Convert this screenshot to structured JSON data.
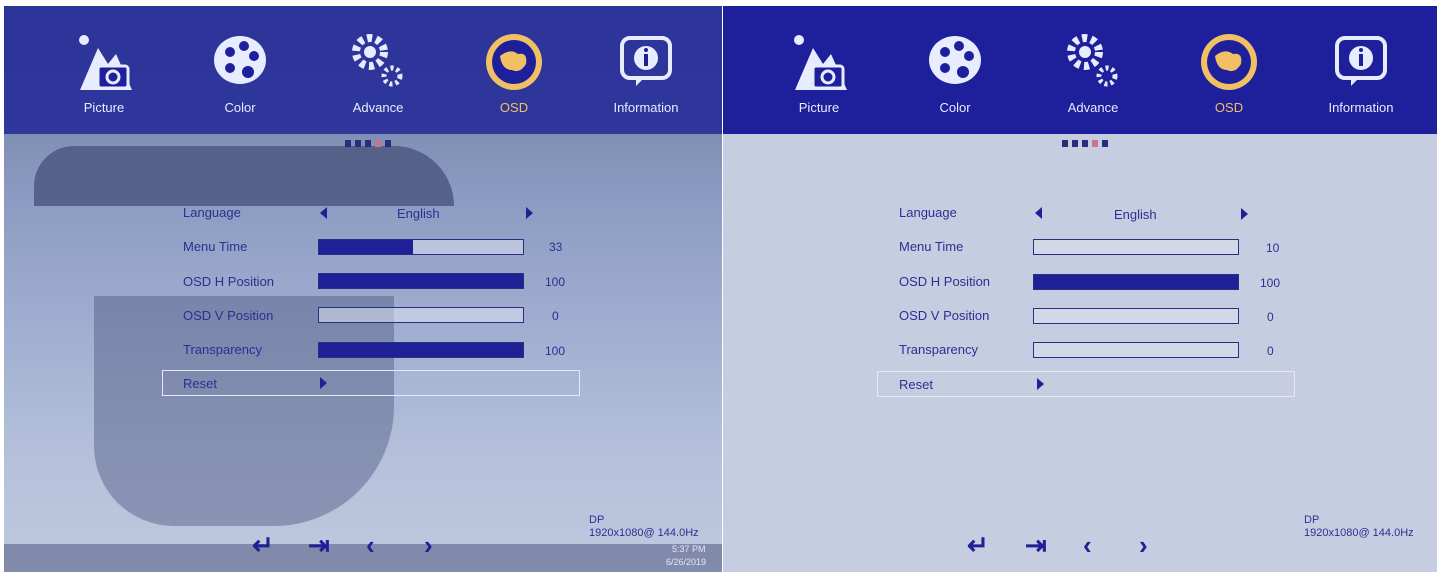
{
  "screens": [
    {
      "tabs": [
        {
          "label": "Picture",
          "icon": "picture-icon"
        },
        {
          "label": "Color",
          "icon": "color-palette-icon"
        },
        {
          "label": "Advance",
          "icon": "gear-icon"
        },
        {
          "label": "OSD",
          "icon": "globe-icon",
          "active": true
        },
        {
          "label": "Information",
          "icon": "info-icon"
        }
      ],
      "settings": {
        "language": {
          "label": "Language",
          "value": "English"
        },
        "menu_time": {
          "label": "Menu Time",
          "value": "33",
          "fraction": 0.46
        },
        "osd_h": {
          "label": "OSD H Position",
          "value": "100",
          "fraction": 1.0
        },
        "osd_v": {
          "label": "OSD V Position",
          "value": "0",
          "fraction": 0.0
        },
        "transparency": {
          "label": "Transparency",
          "value": "100",
          "fraction": 1.0
        },
        "reset": {
          "label": "Reset"
        }
      },
      "status": {
        "input": "DP",
        "resolution": "1920x1080@ 144.0Hz",
        "clock": "5:37 PM",
        "date": "6/26/2019"
      }
    },
    {
      "tabs": [
        {
          "label": "Picture",
          "icon": "picture-icon"
        },
        {
          "label": "Color",
          "icon": "color-palette-icon"
        },
        {
          "label": "Advance",
          "icon": "gear-icon"
        },
        {
          "label": "OSD",
          "icon": "globe-icon",
          "active": true
        },
        {
          "label": "Information",
          "icon": "info-icon"
        }
      ],
      "settings": {
        "language": {
          "label": "Language",
          "value": "English"
        },
        "menu_time": {
          "label": "Menu Time",
          "value": "10",
          "fraction": 0.0
        },
        "osd_h": {
          "label": "OSD H Position",
          "value": "100",
          "fraction": 1.0
        },
        "osd_v": {
          "label": "OSD V Position",
          "value": "0",
          "fraction": 0.0
        },
        "transparency": {
          "label": "Transparency",
          "value": "0",
          "fraction": 0.0
        },
        "reset": {
          "label": "Reset"
        }
      },
      "status": {
        "input": "DP",
        "resolution": "1920x1080@ 144.0Hz"
      }
    }
  ],
  "colors": {
    "header": "#1e1f9b",
    "accent_active": "#f1c064",
    "bar_fill": "#1d2195",
    "text": "#2b2f92"
  },
  "nav_icons": [
    "enter-icon",
    "exit-icon",
    "chevron-left-icon",
    "chevron-right-icon"
  ]
}
